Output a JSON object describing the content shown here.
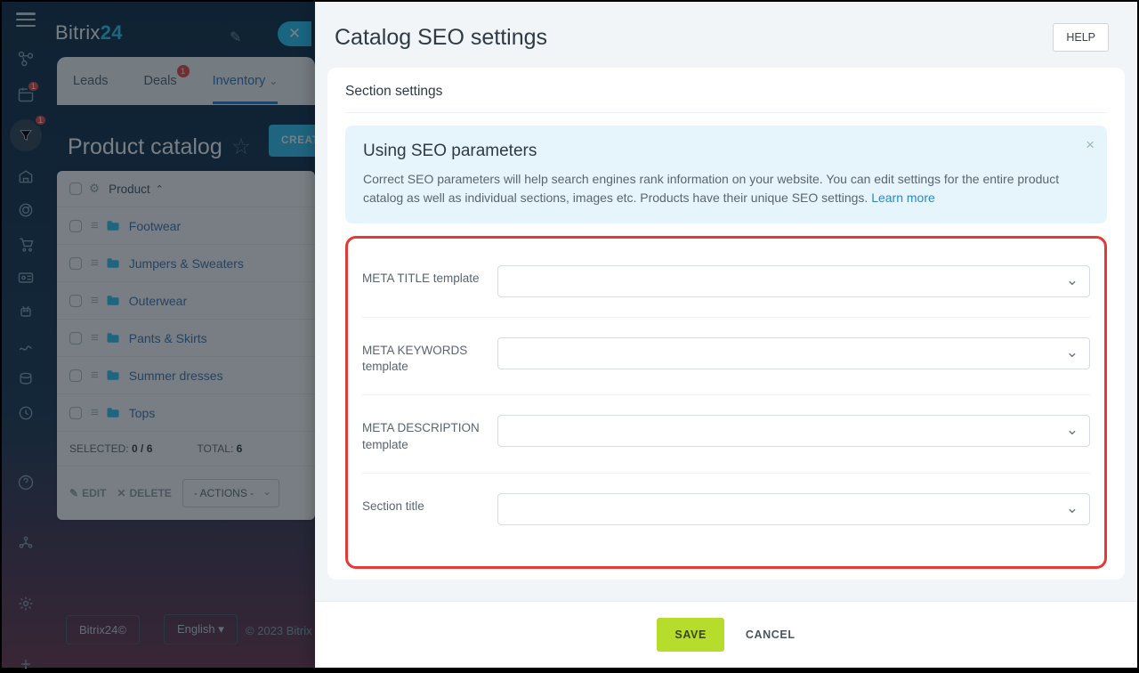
{
  "brand": {
    "p1": "Bitrix",
    "p2": "24"
  },
  "tabs": {
    "leads": "Leads",
    "deals": "Deals",
    "deals_badge": "1",
    "inventory": "Inventory"
  },
  "rail_badges": {
    "cal": "1",
    "filter": "1"
  },
  "page": {
    "title": "Product catalog",
    "create": "CREATE"
  },
  "table": {
    "col": "Product",
    "rows": [
      "Footwear",
      "Jumpers & Sweaters",
      "Outerwear",
      "Pants & Skirts",
      "Summer dresses",
      "Tops"
    ],
    "selected_label": "SELECTED: ",
    "selected_val": "0 / 6",
    "total_label": "TOTAL: ",
    "total_val": "6",
    "edit": "EDIT",
    "delete": "DELETE",
    "actions": "- ACTIONS -"
  },
  "footer": {
    "brand": "Bitrix24©",
    "lang": "English ▾",
    "copy": "© 2023 Bitrix"
  },
  "modal": {
    "title": "Catalog SEO settings",
    "help": "HELP",
    "section": "Section settings",
    "banner_h": "Using SEO parameters",
    "banner_p": "Correct SEO parameters will help search engines rank information on your website. You can edit settings for the entire product catalog as well as individual sections, images etc. Products have their unique SEO settings. ",
    "learn": "Learn more",
    "f1": "META TITLE template",
    "f2": "META KEYWORDS template",
    "f3": "META DESCRIPTION template",
    "f4": "Section title",
    "save": "SAVE",
    "cancel": "CANCEL"
  }
}
